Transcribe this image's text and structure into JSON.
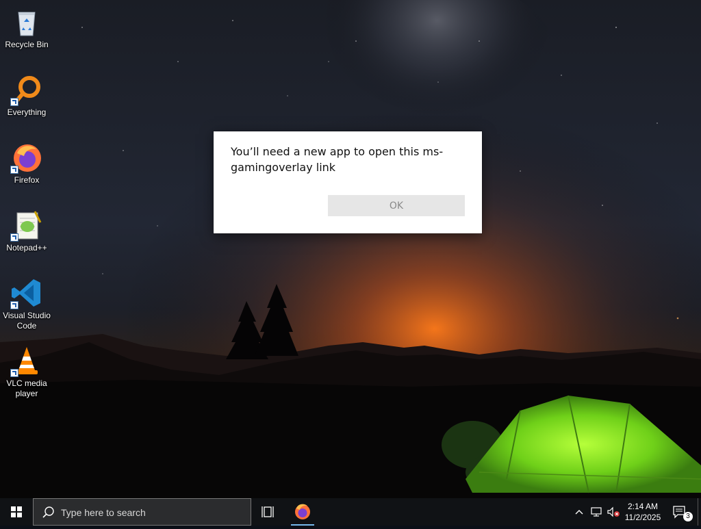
{
  "desktop": {
    "icons": [
      {
        "label": "Recycle Bin",
        "icon": "recycle-bin-icon"
      },
      {
        "label": "Everything",
        "icon": "everything-search-icon"
      },
      {
        "label": "Firefox",
        "icon": "firefox-icon"
      },
      {
        "label": "Notepad++",
        "icon": "notepad-plus-plus-icon"
      },
      {
        "label": "Visual Studio Code",
        "icon": "vscode-icon"
      },
      {
        "label": "VLC media player",
        "icon": "vlc-icon"
      }
    ]
  },
  "dialog": {
    "message": "You’ll need a new app to open this ms-gamingoverlay link",
    "ok_label": "OK"
  },
  "taskbar": {
    "search_placeholder": "Type here to search",
    "time": "2:14 AM",
    "date": "11/2/2025",
    "notification_count": "3",
    "pinned": [
      "task-view-icon",
      "firefox-icon"
    ],
    "tray": [
      "chevron-up-icon",
      "network-icon",
      "volume-muted-icon"
    ]
  },
  "colors": {
    "taskbar": "#101215",
    "accent_bar": "#76b9ed",
    "dialog_button": "#e6e6e6"
  }
}
